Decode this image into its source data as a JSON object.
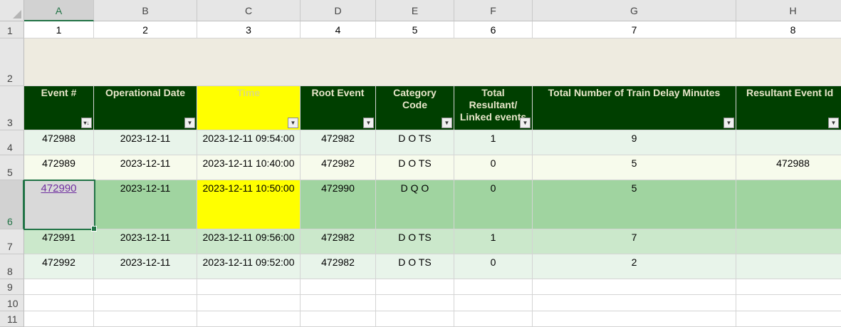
{
  "columns": [
    "A",
    "B",
    "C",
    "D",
    "E",
    "F",
    "G",
    "H"
  ],
  "row_numbers": [
    "1",
    "2",
    "3",
    "4",
    "5",
    "6",
    "7",
    "8",
    "9",
    "10",
    "11"
  ],
  "row1_values": [
    "1",
    "2",
    "3",
    "4",
    "5",
    "6",
    "7",
    "8"
  ],
  "table_headers": [
    "Event #",
    "Operational Date",
    "Time",
    "Root Event",
    "Category Code",
    "Total Resultant/ Linked events",
    "Total Number of Train Delay Minutes",
    "Resultant Event Id"
  ],
  "filter_icons": [
    "sort-filter-icon",
    "dropdown-icon",
    "dropdown-icon",
    "dropdown-icon",
    "dropdown-icon",
    "dropdown-icon",
    "dropdown-icon",
    "dropdown-icon"
  ],
  "rows": [
    [
      "472988",
      "2023-12-11",
      "2023-12-11 09:54:00",
      "472982",
      "D O TS",
      "1",
      "9",
      ""
    ],
    [
      "472989",
      "2023-12-11",
      "2023-12-11 10:40:00",
      "472982",
      "D O TS",
      "0",
      "5",
      "472988"
    ],
    [
      "472990",
      "2023-12-11",
      "2023-12-11 10:50:00",
      "472990",
      "D Q O",
      "0",
      "5",
      ""
    ],
    [
      "472991",
      "2023-12-11",
      "2023-12-11 09:56:00",
      "472982",
      "D O TS",
      "1",
      "7",
      ""
    ],
    [
      "472992",
      "2023-12-11",
      "2023-12-11 09:52:00",
      "472982",
      "D O TS",
      "0",
      "2",
      ""
    ]
  ],
  "active_cell": "A6",
  "colors": {
    "header_bg": "#003f00",
    "header_text": "#e7e6c9",
    "highlight_yellow": "#ffff00",
    "band_light": "#e8f4ea",
    "band_cream": "#f7fbec",
    "band_selected": "#a0d4a0",
    "band_mid": "#cbe8cb",
    "excel_green": "#217346",
    "link_purple": "#7030a0"
  }
}
